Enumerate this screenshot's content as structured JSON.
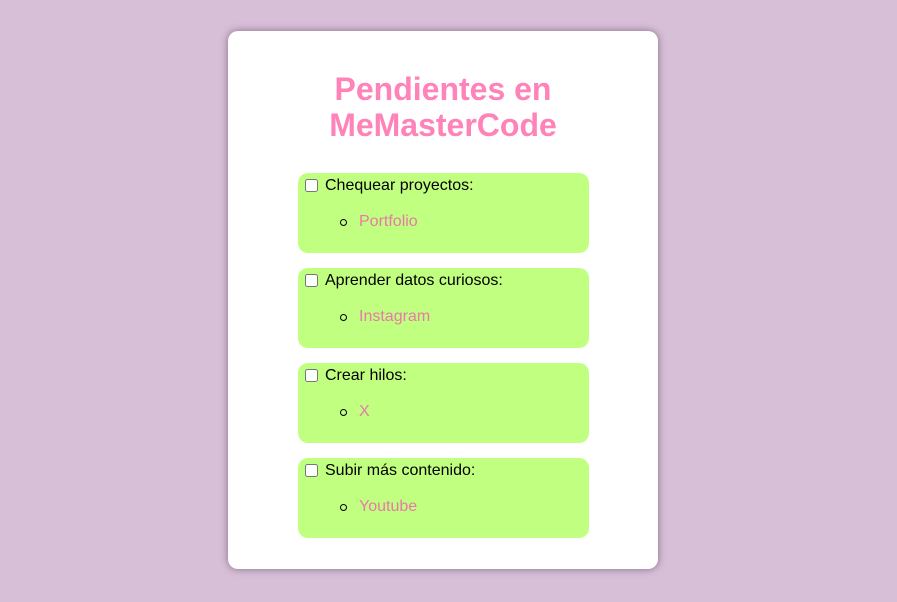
{
  "page": {
    "title": "Pendientes en MeMasterCode",
    "title_color": "#ff82b8",
    "background_color": "#d8bfd8",
    "task_color": "#c0ff80",
    "link_color": "#e87aa8"
  },
  "tasks": [
    {
      "label": "Chequear proyectos:",
      "checked": false,
      "links": [
        {
          "label": "Portfolio"
        }
      ]
    },
    {
      "label": "Aprender datos curiosos:",
      "checked": false,
      "links": [
        {
          "label": "Instagram"
        }
      ]
    },
    {
      "label": "Crear hilos:",
      "checked": false,
      "links": [
        {
          "label": "X"
        }
      ]
    },
    {
      "label": "Subir más contenido:",
      "checked": false,
      "links": [
        {
          "label": "Youtube"
        }
      ]
    }
  ]
}
